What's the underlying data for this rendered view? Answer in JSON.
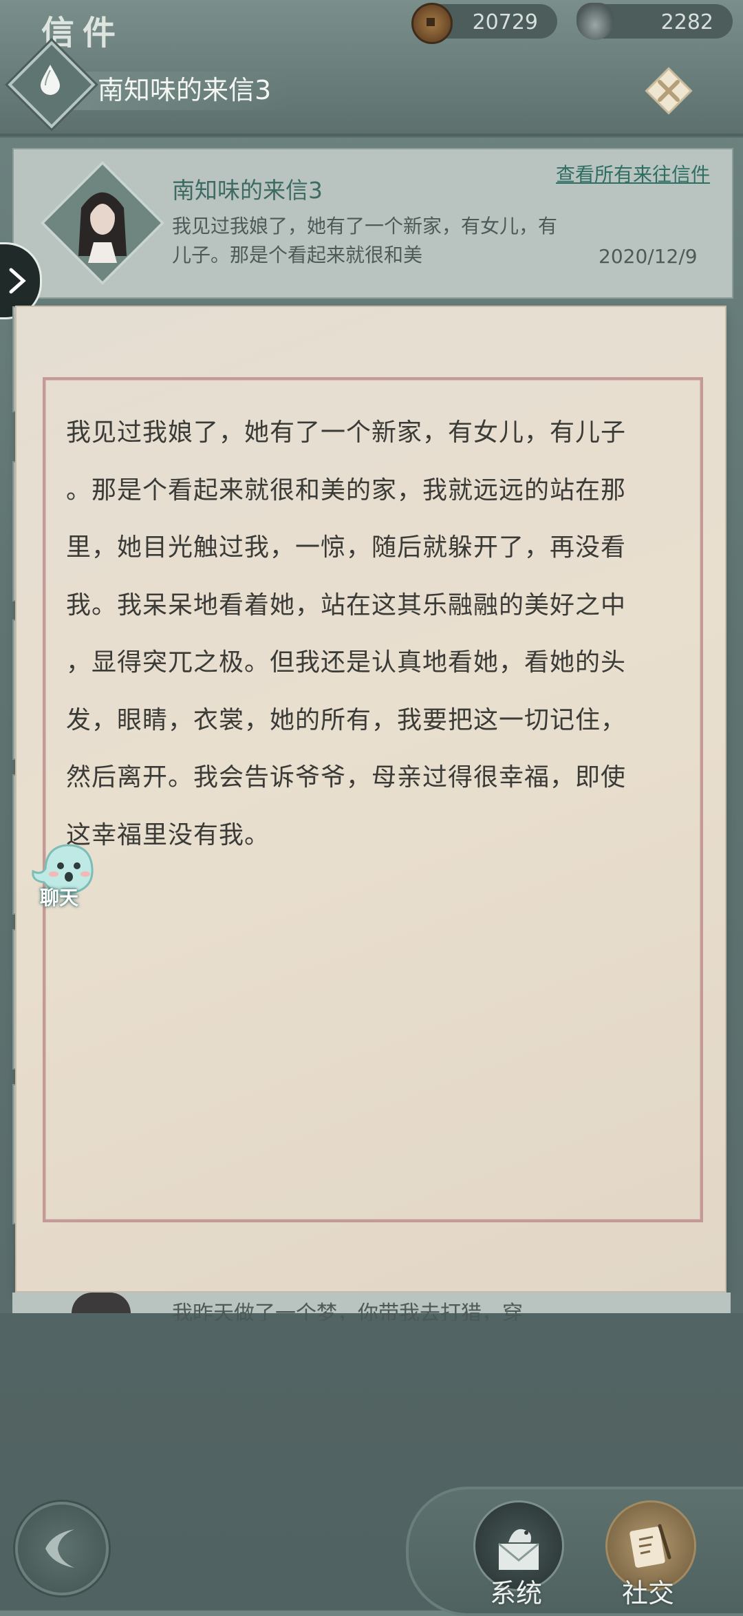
{
  "app": {
    "title": "信件"
  },
  "currency": {
    "coins": "20729",
    "silver": "2282"
  },
  "header": {
    "title": "南知味的来信3"
  },
  "card": {
    "title": "南知味的来信3",
    "link_label": "查看所有来往信件",
    "preview": "我见过我娘了，她有了一个新家，有女儿，有儿子。那是个看起来就很和美",
    "date": "2020/12/9"
  },
  "letter": {
    "lines": [
      "我见过我娘了，她有了一个新家，有女儿，有儿子",
      "。那是个看起来就很和美的家，我就远远的站在那",
      "里，她目光触过我，一惊，随后就躲开了，再没看",
      "我。我呆呆地看着她，站在这其乐融融的美好之中",
      "，显得突兀之极。但我还是认真地看她，看她的头",
      "发，眼睛，衣裳，她的所有，我要把这一切记住，",
      "然后离开。我会告诉爷爷，母亲过得很幸福，即使",
      "这幸福里没有我。"
    ]
  },
  "next_item": {
    "preview": "我昨天做了一个梦，你带我去打猎，穿"
  },
  "chat": {
    "label": "聊天"
  },
  "bottom_nav": {
    "system_label": "系统",
    "social_label": "社交"
  },
  "icons": {
    "coin": "copper-coin-icon",
    "silver": "silver-ingot-icon",
    "drop": "water-drop-icon",
    "close": "close-x-icon",
    "expand": "chevron-right-icon",
    "back": "back-arrow-icon",
    "system": "envelope-bird-icon",
    "social": "scroll-brush-icon",
    "chat": "chat-ghost-icon"
  },
  "colors": {
    "accent": "#2f6f63",
    "paper": "#e6dccc",
    "border": "#c49a99"
  }
}
